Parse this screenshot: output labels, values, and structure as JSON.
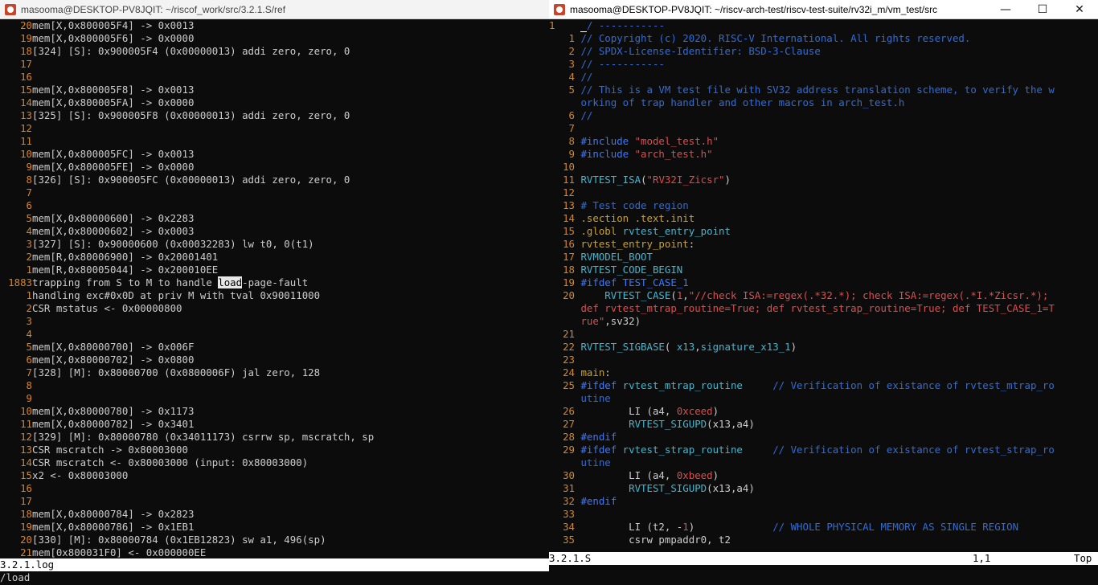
{
  "left_window": {
    "title": "masooma@DESKTOP-PV8JQIT: ~/riscof_work/src/3.2.1.S/ref",
    "lines": [
      {
        "n": "20",
        "t": "mem[X,0x800005F4] -> 0x0013"
      },
      {
        "n": "19",
        "t": "mem[X,0x800005F6] -> 0x0000"
      },
      {
        "n": "18",
        "t": "[324] [S]: 0x900005F4 (0x00000013) addi zero, zero, 0"
      },
      {
        "n": "17",
        "t": ""
      },
      {
        "n": "16",
        "t": ""
      },
      {
        "n": "15",
        "t": "mem[X,0x800005F8] -> 0x0013"
      },
      {
        "n": "14",
        "t": "mem[X,0x800005FA] -> 0x0000"
      },
      {
        "n": "13",
        "t": "[325] [S]: 0x900005F8 (0x00000013) addi zero, zero, 0"
      },
      {
        "n": "12",
        "t": ""
      },
      {
        "n": "11",
        "t": ""
      },
      {
        "n": "10",
        "t": "mem[X,0x800005FC] -> 0x0013"
      },
      {
        "n": "9",
        "t": "mem[X,0x800005FE] -> 0x0000"
      },
      {
        "n": "8",
        "t": "[326] [S]: 0x900005FC (0x00000013) addi zero, zero, 0"
      },
      {
        "n": "7",
        "t": ""
      },
      {
        "n": "6",
        "t": ""
      },
      {
        "n": "5",
        "t": "mem[X,0x80000600] -> 0x2283"
      },
      {
        "n": "4",
        "t": "mem[X,0x80000602] -> 0x0003"
      },
      {
        "n": "3",
        "t": "[327] [S]: 0x90000600 (0x00032283) lw t0, 0(t1)"
      },
      {
        "n": "2",
        "t": "mem[R,0x80006900] -> 0x20001401"
      },
      {
        "n": "1",
        "t": "mem[R,0x80005044] -> 0x200010EE"
      },
      {
        "n": "1883",
        "t": "trapping from S to M to handle load-page-fault",
        "pre": "trapping from S to M to handle ",
        "hl": "load",
        "post": "-page-fault"
      },
      {
        "n": "1",
        "t": "handling exc#0x0D at priv M with tval 0x90011000"
      },
      {
        "n": "2",
        "t": "CSR mstatus <- 0x00000800"
      },
      {
        "n": "3",
        "t": ""
      },
      {
        "n": "4",
        "t": ""
      },
      {
        "n": "5",
        "t": "mem[X,0x80000700] -> 0x006F"
      },
      {
        "n": "6",
        "t": "mem[X,0x80000702] -> 0x0800"
      },
      {
        "n": "7",
        "t": "[328] [M]: 0x80000700 (0x0800006F) jal zero, 128"
      },
      {
        "n": "8",
        "t": ""
      },
      {
        "n": "9",
        "t": ""
      },
      {
        "n": "10",
        "t": "mem[X,0x80000780] -> 0x1173"
      },
      {
        "n": "11",
        "t": "mem[X,0x80000782] -> 0x3401"
      },
      {
        "n": "12",
        "t": "[329] [M]: 0x80000780 (0x34011173) csrrw sp, mscratch, sp"
      },
      {
        "n": "13",
        "t": "CSR mscratch -> 0x80003000"
      },
      {
        "n": "14",
        "t": "CSR mscratch <- 0x80003000 (input: 0x80003000)"
      },
      {
        "n": "15",
        "t": "x2 <- 0x80003000"
      },
      {
        "n": "16",
        "t": ""
      },
      {
        "n": "17",
        "t": ""
      },
      {
        "n": "18",
        "t": "mem[X,0x80000784] -> 0x2823"
      },
      {
        "n": "19",
        "t": "mem[X,0x80000786] -> 0x1EB1"
      },
      {
        "n": "20",
        "t": "[330] [M]: 0x80000784 (0x1EB12823) sw a1, 496(sp)"
      },
      {
        "n": "21",
        "t": "mem[0x800031F0] <- 0x000000EE"
      }
    ],
    "status": "3.2.1.log",
    "command": "/load"
  },
  "right_window": {
    "title": "masooma@DESKTOP-PV8JQIT: ~/riscv-arch-test/riscv-test-suite/rv32i_m/vm_test/src",
    "controls": {
      "minimize": "—",
      "maximize": "☐",
      "close": "✕"
    },
    "status_file": "3.2.1.S",
    "status_pos": "1,1",
    "status_scroll": "Top",
    "lines": [
      {
        "n": "1",
        "segs": [
          {
            "c": "cursor",
            "t": " "
          },
          {
            "c": "com",
            "t": "/ -----------"
          }
        ]
      },
      {
        "n": "1",
        "segs": [
          {
            "c": "com",
            "t": "// Copyright (c) 2020. RISC-V International. All rights reserved."
          }
        ]
      },
      {
        "n": "2",
        "segs": [
          {
            "c": "com",
            "t": "// SPDX-License-Identifier: BSD-3-Clause"
          }
        ]
      },
      {
        "n": "3",
        "segs": [
          {
            "c": "com",
            "t": "// -----------"
          }
        ]
      },
      {
        "n": "4",
        "segs": [
          {
            "c": "com",
            "t": "//"
          }
        ]
      },
      {
        "n": "5",
        "segs": [
          {
            "c": "com",
            "t": "// This is a VM test file with SV32 address translation scheme, to verify the w"
          }
        ]
      },
      {
        "n": "",
        "segs": [
          {
            "c": "com",
            "t": "orking of trap handler and other macros in arch_test.h"
          }
        ]
      },
      {
        "n": "6",
        "segs": [
          {
            "c": "com",
            "t": "//"
          }
        ]
      },
      {
        "n": "7",
        "segs": []
      },
      {
        "n": "8",
        "segs": [
          {
            "c": "pre",
            "t": "#include "
          },
          {
            "c": "str",
            "t": "\"model_test.h\""
          }
        ]
      },
      {
        "n": "9",
        "segs": [
          {
            "c": "pre",
            "t": "#include "
          },
          {
            "c": "str",
            "t": "\"arch_test.h\""
          }
        ]
      },
      {
        "n": "10",
        "segs": []
      },
      {
        "n": "11",
        "segs": [
          {
            "c": "mac",
            "t": "RVTEST_ISA"
          },
          {
            "c": "plain",
            "t": "("
          },
          {
            "c": "str",
            "t": "\"RV32I_Zicsr\""
          },
          {
            "c": "plain",
            "t": ")"
          }
        ]
      },
      {
        "n": "12",
        "segs": []
      },
      {
        "n": "13",
        "segs": [
          {
            "c": "com",
            "t": "# Test code region"
          }
        ]
      },
      {
        "n": "14",
        "segs": [
          {
            "c": "def",
            "t": ".section .text.init"
          }
        ]
      },
      {
        "n": "15",
        "segs": [
          {
            "c": "def",
            "t": ".globl "
          },
          {
            "c": "ident",
            "t": "rvtest_entry_point"
          }
        ]
      },
      {
        "n": "16",
        "segs": [
          {
            "c": "def",
            "t": "rvtest_entry_point"
          },
          {
            "c": "plain",
            "t": ":"
          }
        ]
      },
      {
        "n": "17",
        "segs": [
          {
            "c": "mac",
            "t": "RVMODEL_BOOT"
          }
        ]
      },
      {
        "n": "18",
        "segs": [
          {
            "c": "mac",
            "t": "RVTEST_CODE_BEGIN"
          }
        ]
      },
      {
        "n": "19",
        "segs": [
          {
            "c": "pre",
            "t": "#ifdef TEST_CASE_1"
          }
        ]
      },
      {
        "n": "20",
        "segs": [
          {
            "c": "mac",
            "t": "    RVTEST_CASE"
          },
          {
            "c": "plain",
            "t": "("
          },
          {
            "c": "num",
            "t": "1"
          },
          {
            "c": "plain",
            "t": ","
          },
          {
            "c": "str",
            "t": "\"//check ISA:=regex(.*32.*); check ISA:=regex(.*I.*Zicsr.*);"
          }
        ]
      },
      {
        "n": "",
        "segs": [
          {
            "c": "str",
            "t": "def rvtest_mtrap_routine=True; def rvtest_strap_routine=True; def TEST_CASE_1=T"
          }
        ]
      },
      {
        "n": "",
        "segs": [
          {
            "c": "str",
            "t": "rue\""
          },
          {
            "c": "plain",
            "t": ",sv32)"
          }
        ]
      },
      {
        "n": "21",
        "segs": []
      },
      {
        "n": "22",
        "segs": [
          {
            "c": "mac",
            "t": "RVTEST_SIGBASE"
          },
          {
            "c": "plain",
            "t": "( "
          },
          {
            "c": "ident",
            "t": "x13"
          },
          {
            "c": "plain",
            "t": ","
          },
          {
            "c": "ident",
            "t": "signature_x13_1"
          },
          {
            "c": "plain",
            "t": ")"
          }
        ]
      },
      {
        "n": "23",
        "segs": []
      },
      {
        "n": "24",
        "segs": [
          {
            "c": "def",
            "t": "main"
          },
          {
            "c": "plain",
            "t": ":"
          }
        ]
      },
      {
        "n": "25",
        "segs": [
          {
            "c": "pre",
            "t": "#ifdef "
          },
          {
            "c": "ident",
            "t": "rvtest_mtrap_routine"
          },
          {
            "c": "plain",
            "t": "     "
          },
          {
            "c": "com",
            "t": "// Verification of existance of rvtest_mtrap_ro"
          }
        ]
      },
      {
        "n": "",
        "segs": [
          {
            "c": "com",
            "t": "utine"
          }
        ]
      },
      {
        "n": "26",
        "segs": [
          {
            "c": "plain",
            "t": "        LI (a4, "
          },
          {
            "c": "num",
            "t": "0xceed"
          },
          {
            "c": "plain",
            "t": ")"
          }
        ]
      },
      {
        "n": "27",
        "segs": [
          {
            "c": "mac",
            "t": "        RVTEST_SIGUPD"
          },
          {
            "c": "plain",
            "t": "(x13,a4)"
          }
        ]
      },
      {
        "n": "28",
        "segs": [
          {
            "c": "pre",
            "t": "#endif"
          }
        ]
      },
      {
        "n": "29",
        "segs": [
          {
            "c": "pre",
            "t": "#ifdef "
          },
          {
            "c": "ident",
            "t": "rvtest_strap_routine"
          },
          {
            "c": "plain",
            "t": "     "
          },
          {
            "c": "com",
            "t": "// Verification of existance of rvtest_strap_ro"
          }
        ]
      },
      {
        "n": "",
        "segs": [
          {
            "c": "com",
            "t": "utine"
          }
        ]
      },
      {
        "n": "30",
        "segs": [
          {
            "c": "plain",
            "t": "        LI (a4, "
          },
          {
            "c": "num",
            "t": "0xbeed"
          },
          {
            "c": "plain",
            "t": ")"
          }
        ]
      },
      {
        "n": "31",
        "segs": [
          {
            "c": "mac",
            "t": "        RVTEST_SIGUPD"
          },
          {
            "c": "plain",
            "t": "(x13,a4)"
          }
        ]
      },
      {
        "n": "32",
        "segs": [
          {
            "c": "pre",
            "t": "#endif"
          }
        ]
      },
      {
        "n": "33",
        "segs": []
      },
      {
        "n": "34",
        "segs": [
          {
            "c": "plain",
            "t": "        LI (t2, -"
          },
          {
            "c": "num",
            "t": "1"
          },
          {
            "c": "plain",
            "t": ")             "
          },
          {
            "c": "com",
            "t": "// WHOLE PHYSICAL MEMORY AS SINGLE REGION"
          }
        ]
      },
      {
        "n": "35",
        "segs": [
          {
            "c": "plain",
            "t": "        csrw pmpaddr0, t2"
          }
        ]
      }
    ]
  },
  "colors": {
    "background": "#0c0c0c",
    "line_number": "#d7861e",
    "comment": "#2f6cd6",
    "string": "#e04b4b",
    "identifier": "#3fb8d1"
  }
}
